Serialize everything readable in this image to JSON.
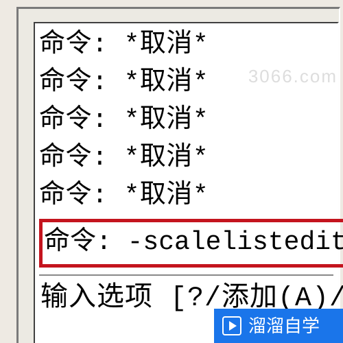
{
  "watermark": "3066.com",
  "lines": {
    "l1": "命令: *取消*",
    "l2": "命令: *取消*",
    "l3": "命令: *取消*",
    "l4": "命令: *取消*",
    "l5": "命令: *取消*",
    "highlighted": "命令: -scalelistedit",
    "input_prompt": "输入选项 [?/添加(A)/册"
  },
  "badge": {
    "text": "溜溜自学"
  },
  "colors": {
    "highlight_border": "#c4141e",
    "badge_bg": "#1a75ea"
  }
}
